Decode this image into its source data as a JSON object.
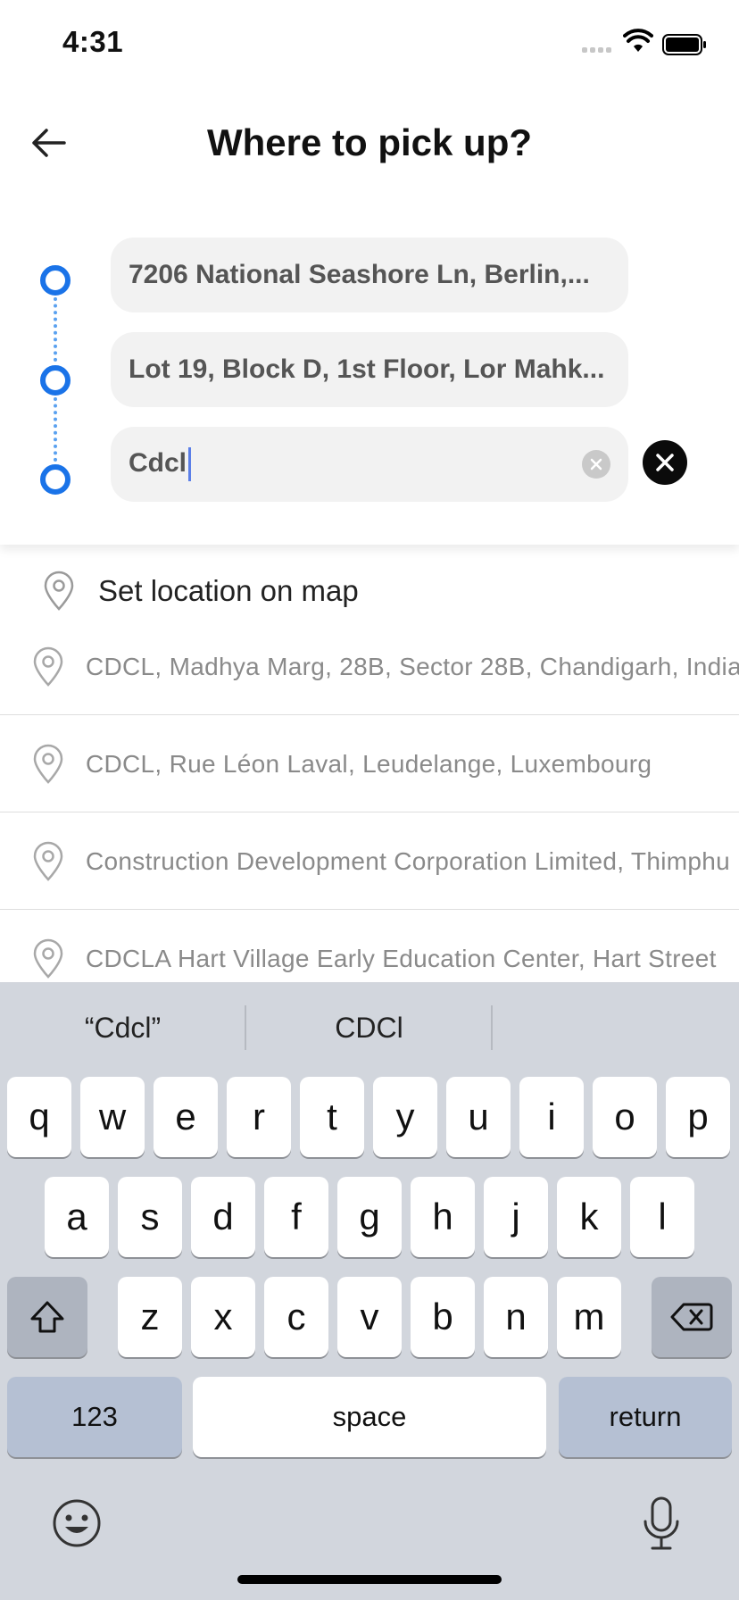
{
  "status_bar": {
    "time": "4:31"
  },
  "header": {
    "title": "Where to pick up?"
  },
  "stops": {
    "pickup": "7206 National Seashore Ln, Berlin,...",
    "stop_2": "Lot 19, Block D, 1st Floor, Lor Mahk...",
    "current_query": "Cdcl"
  },
  "list": {
    "set_location_label": "Set location on map",
    "suggestions": [
      "CDCL, Madhya Marg, 28B, Sector 28B, Chandigarh, India",
      "CDCL, Rue Léon Laval, Leudelange, Luxembourg",
      "Construction Development Corporation Limited, Thimphu",
      "CDCLA Hart Village Early Education Center, Hart Street"
    ]
  },
  "keyboard": {
    "predictions": [
      "“Cdcl”",
      "CDCl",
      ""
    ],
    "row1": [
      "q",
      "w",
      "e",
      "r",
      "t",
      "y",
      "u",
      "i",
      "o",
      "p"
    ],
    "row2": [
      "a",
      "s",
      "d",
      "f",
      "g",
      "h",
      "j",
      "k",
      "l"
    ],
    "row3": [
      "z",
      "x",
      "c",
      "v",
      "b",
      "n",
      "m"
    ],
    "numbers_label": "123",
    "space_label": "space",
    "return_label": "return"
  },
  "icons": {
    "back": "arrow-left-icon",
    "pin": "location-pin-icon",
    "clear": "clear-circle-icon",
    "remove": "close-circle-icon",
    "shift": "shift-icon",
    "delete": "backspace-icon",
    "emoji": "emoji-icon",
    "mic": "microphone-icon"
  },
  "colors": {
    "accent": "#1a73e8",
    "route_line": "#5aa1f0",
    "keyboard_bg": "#d2d6dd"
  }
}
